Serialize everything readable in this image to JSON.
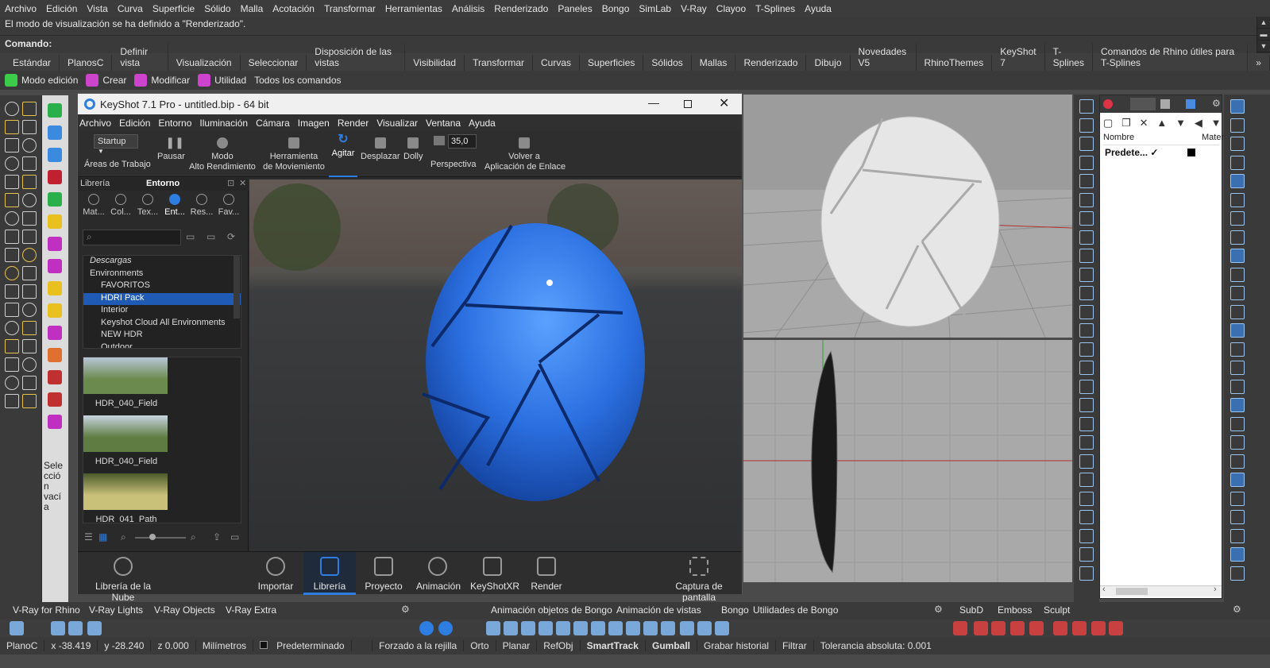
{
  "menubar": [
    "Archivo",
    "Edición",
    "Vista",
    "Curva",
    "Superficie",
    "Sólido",
    "Malla",
    "Acotación",
    "Transformar",
    "Herramientas",
    "Análisis",
    "Renderizado",
    "Paneles",
    "Bongo",
    "SimLab",
    "V-Ray",
    "Clayoo",
    "T-Splines",
    "Ayuda"
  ],
  "command": {
    "history": "El modo de visualización se ha definido a \"Renderizado\".",
    "prompt": "Comando:"
  },
  "tabs": [
    "Estándar",
    "PlanosC",
    "Definir vista",
    "Visualización",
    "Seleccionar",
    "Disposición de las vistas",
    "Visibilidad",
    "Transformar",
    "Curvas",
    "Superficies",
    "Sólidos",
    "Mallas",
    "Renderizado",
    "Dibujo",
    "Novedades V5",
    "RhinoThemes",
    "KeyShot 7",
    "T-Splines",
    "Comandos de Rhino útiles para T-Splines"
  ],
  "tabs_overflow": "»",
  "cmdrow": [
    {
      "label": "Modo edición",
      "color": "#3dcc4a"
    },
    {
      "label": "Crear",
      "color": "#cc44cc"
    },
    {
      "label": "Modificar",
      "color": "#cc44cc"
    },
    {
      "label": "Utilidad",
      "color": "#cc44cc"
    },
    {
      "label": "Todos los comandos",
      "color": ""
    }
  ],
  "left_selection_label": "Sele\ncció\nn\nvací\na",
  "keyshot": {
    "title": "KeyShot 7.1 Pro  - untitled.bip  - 64 bit",
    "menu": [
      "Archivo",
      "Edición",
      "Entorno",
      "Iluminación",
      "Cámara",
      "Imagen",
      "Render",
      "Visualizar",
      "Ventana",
      "Ayuda"
    ],
    "workspace": "Startup",
    "toolbar": [
      {
        "label": "Áreas de Trabajo"
      },
      {
        "label": "Pausar"
      },
      {
        "label": "Modo\nAlto Rendimiento"
      },
      {
        "label": "Herramienta\nde Moviemiento"
      },
      {
        "label": "Agitar"
      },
      {
        "label": "Desplazar"
      },
      {
        "label": "Dolly"
      },
      {
        "label": "Perspectiva"
      },
      {
        "label": "Volver a\nAplicación de Enlace"
      }
    ],
    "fov": "35,0",
    "library": {
      "tabs": [
        "Librería",
        "Entorno"
      ],
      "categories": [
        "Mat...",
        "Col...",
        "Tex...",
        "Ent...",
        "Res...",
        "Fav..."
      ],
      "tree": [
        "Descargas",
        "Environments",
        "FAVORITOS",
        "HDRI Pack",
        "Interior",
        "Keyshot Cloud All Environments",
        "NEW HDR",
        "Outdoor"
      ],
      "selected": "HDRI Pack",
      "thumbs": [
        "HDR_040_Field",
        "HDR_040_Field",
        "HDR_041_Path"
      ]
    },
    "bottom": [
      "Librería de la Nube",
      "Importar",
      "Librería",
      "Proyecto",
      "Animación",
      "KeyShotXR",
      "Render",
      "Captura de pantalla"
    ],
    "bottom_active": "Librería"
  },
  "rpanel": {
    "col1": "Nombre",
    "col2": "Materi",
    "row": "Predete...",
    "check": "✓"
  },
  "bottom_tabs_left": [
    "V-Ray for Rhino",
    "V-Ray Lights",
    "V-Ray Objects",
    "V-Ray Extra"
  ],
  "bottom_tabs_mid": [
    "Animación objetos de Bongo",
    "Animación de vistas",
    "Bongo",
    "Utilidades de Bongo"
  ],
  "bottom_tabs_right": [
    "SubD",
    "Emboss",
    "Sculpt"
  ],
  "status": {
    "plane": "PlanoC",
    "x": "x -38.419",
    "y": "y -28.240",
    "z": "z 0.000",
    "units": "Milímetros",
    "layer": "Predeterminado",
    "items": [
      "Forzado a la rejilla",
      "Orto",
      "Planar",
      "RefObj",
      "SmartTrack",
      "Gumball",
      "Grabar historial",
      "Filtrar"
    ],
    "tolerance": "Tolerancia absoluta: 0.001"
  },
  "colors": {
    "accent_blue": "#2e7de0",
    "ks_selected": "#1f5bb5"
  }
}
